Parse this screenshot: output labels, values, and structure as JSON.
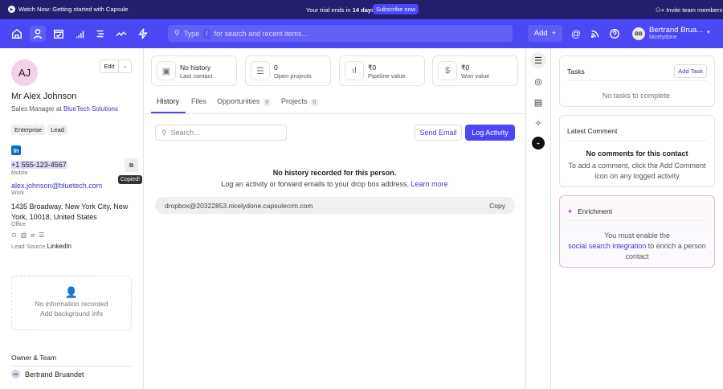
{
  "topbar": {
    "watch": "Watch Now: Getting started with Capsule",
    "trial_prefix": "Your trial ends in",
    "trial_days": "14 days",
    "subscribe": "Subscribe now",
    "invite": "Invite team members"
  },
  "nav": {
    "search_type": "Type",
    "search_key": "/",
    "search_rest": "for search and recent items...",
    "add": "Add",
    "user_name": "Bertrand Brua...",
    "user_org": "Nicelydone",
    "user_initials": "BB"
  },
  "contact": {
    "initials": "AJ",
    "edit": "Edit",
    "name": "Mr Alex Johnson",
    "title_prefix": "Sales Manager at",
    "company": "BlueTech Solutions",
    "tags": [
      "Enterprise",
      "Lead"
    ],
    "phone": "+1 555-123-4567",
    "phone_label": "Mobile",
    "copied": "Copied!",
    "email": "alex.johnson@bluetech.com",
    "email_label": "Work",
    "address": "1435 Broadway, New York City, New York, 10018, United States",
    "address_label": "Office",
    "lead_source_label": "Lead Source",
    "lead_source": "LinkedIn",
    "bg_empty": "No information recorded",
    "bg_add": "Add background info",
    "owner_heading": "Owner & Team",
    "owner_initials": "BB",
    "owner": "Bertrand Bruandet"
  },
  "stats": [
    {
      "value": "No history",
      "label": "Last contact"
    },
    {
      "value": "0",
      "label": "Open projects"
    },
    {
      "value": "₹0",
      "label": "Pipeline value"
    },
    {
      "value": "₹0",
      "label": "Won value"
    }
  ],
  "tabs": [
    {
      "label": "History"
    },
    {
      "label": "Files"
    },
    {
      "label": "Opportunities",
      "count": "0"
    },
    {
      "label": "Projects",
      "count": "0"
    }
  ],
  "history": {
    "search_placeholder": "Search...",
    "send_email": "Send Email",
    "log_activity": "Log Activity",
    "empty_title": "No history recorded for this person.",
    "empty_text": "Log an activity or forward emails to your drop box address.",
    "learn_more": "Learn more",
    "dropbox": "dropbox@20322853.nicelydone.capsulecrm.com",
    "copy": "Copy"
  },
  "right": {
    "tasks_title": "Tasks",
    "add_task": "Add Task",
    "tasks_empty": "No tasks to complete.",
    "comment_title": "Latest Comment",
    "comment_empty_title": "No comments for this contact",
    "comment_empty_text": "To add a comment, click the Add Comment icon on any logged activity",
    "enrich_title": "Enrichment",
    "enrich_pre": "You must enable the",
    "enrich_link": "social search integration",
    "enrich_post": "to enrich a person contact"
  }
}
